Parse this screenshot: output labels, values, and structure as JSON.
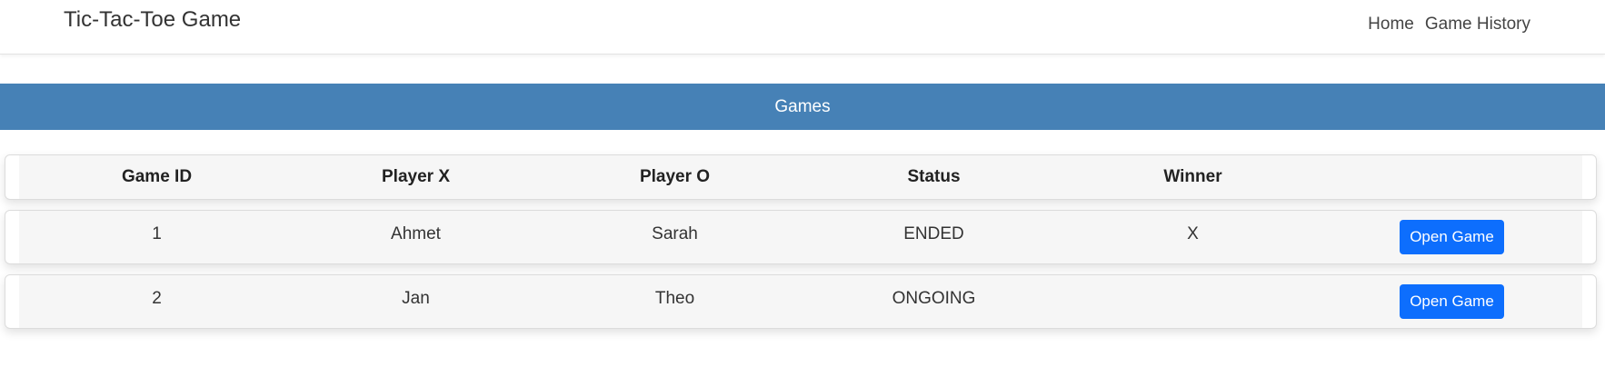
{
  "navbar": {
    "brand": "Tic-Tac-Toe Game",
    "links": [
      "Home",
      "Game History"
    ]
  },
  "banner": {
    "title": "Games"
  },
  "table": {
    "headers": [
      "Game ID",
      "Player X",
      "Player O",
      "Status",
      "Winner",
      ""
    ],
    "rows": [
      {
        "id": "1",
        "player_x": "Ahmet",
        "player_o": "Sarah",
        "status": "ENDED",
        "winner": "X",
        "action": "Open Game"
      },
      {
        "id": "2",
        "player_x": "Jan",
        "player_o": "Theo",
        "status": "ONGOING",
        "winner": "",
        "action": "Open Game"
      }
    ]
  },
  "colors": {
    "banner": "#4681b6",
    "button": "#0d6efd",
    "row_background": "#f6f6f6"
  }
}
